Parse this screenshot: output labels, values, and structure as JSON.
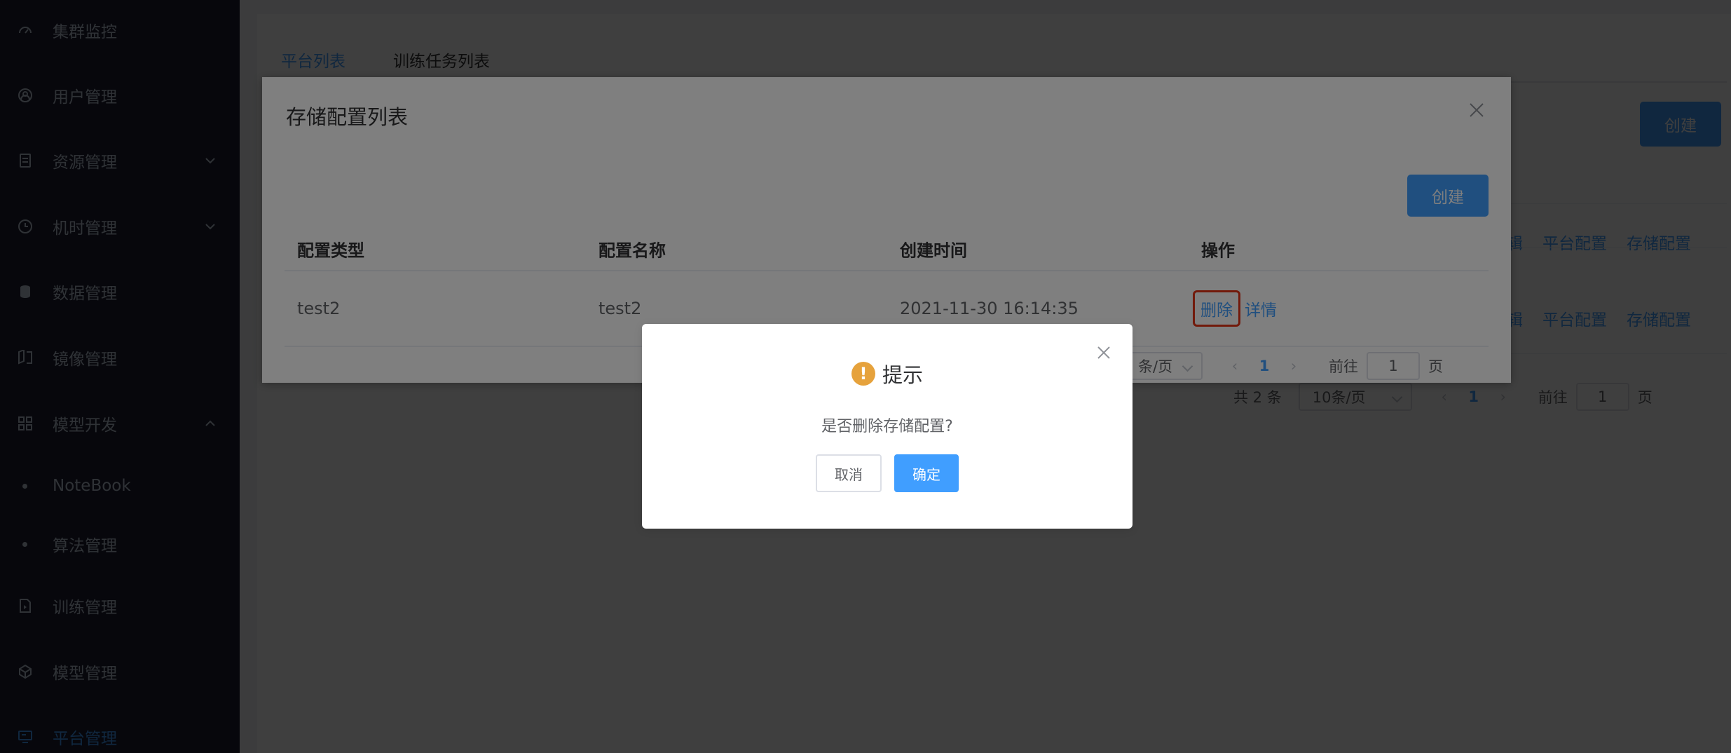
{
  "sidebar": {
    "items": [
      {
        "label": "集群监控",
        "icon": "dashboard-icon"
      },
      {
        "label": "用户管理",
        "icon": "user-icon"
      },
      {
        "label": "资源管理",
        "icon": "document-icon",
        "arrow": "down"
      },
      {
        "label": "机时管理",
        "icon": "clock-icon",
        "arrow": "down"
      },
      {
        "label": "数据管理",
        "icon": "database-icon"
      },
      {
        "label": "镜像管理",
        "icon": "mirror-icon"
      },
      {
        "label": "模型开发",
        "icon": "grid-icon",
        "arrow": "up"
      },
      {
        "label": "NoteBook",
        "sub": true
      },
      {
        "label": "算法管理",
        "sub": true
      },
      {
        "label": "训练管理",
        "icon": "file-icon"
      },
      {
        "label": "模型管理",
        "icon": "cube-icon"
      },
      {
        "label": "平台管理",
        "icon": "monitor-icon",
        "active": true
      }
    ]
  },
  "main": {
    "tabs": [
      {
        "label": "平台列表",
        "active": true
      },
      {
        "label": "训练任务列表",
        "active": false
      }
    ],
    "create_label": "创建",
    "row_actions": [
      "辑",
      "平台配置",
      "存储配置"
    ],
    "pager": {
      "total": "共 2 条",
      "page_size": "10条/页",
      "current_page": "1",
      "goto_label": "前往",
      "goto_value": "1",
      "page_suffix": "页"
    }
  },
  "storage_dialog": {
    "title": "存储配置列表",
    "create_label": "创建",
    "columns": [
      "配置类型",
      "配置名称",
      "创建时间",
      "操作"
    ],
    "rows": [
      {
        "type": "test2",
        "name": "test2",
        "created": "2021-11-30 16:14:35",
        "actions": [
          "删除",
          "详情"
        ]
      }
    ],
    "pager": {
      "page_size_partial": "条/页",
      "current_page": "1",
      "goto_label": "前往",
      "goto_value": "1",
      "page_suffix": "页"
    }
  },
  "confirm": {
    "title": "提示",
    "message": "是否删除存储配置?",
    "cancel_label": "取消",
    "ok_label": "确定"
  },
  "colors": {
    "primary": "#409eff",
    "sidebar_bg": "#1e1f33",
    "warning": "#e6a23c",
    "highlight": "#e53517"
  }
}
